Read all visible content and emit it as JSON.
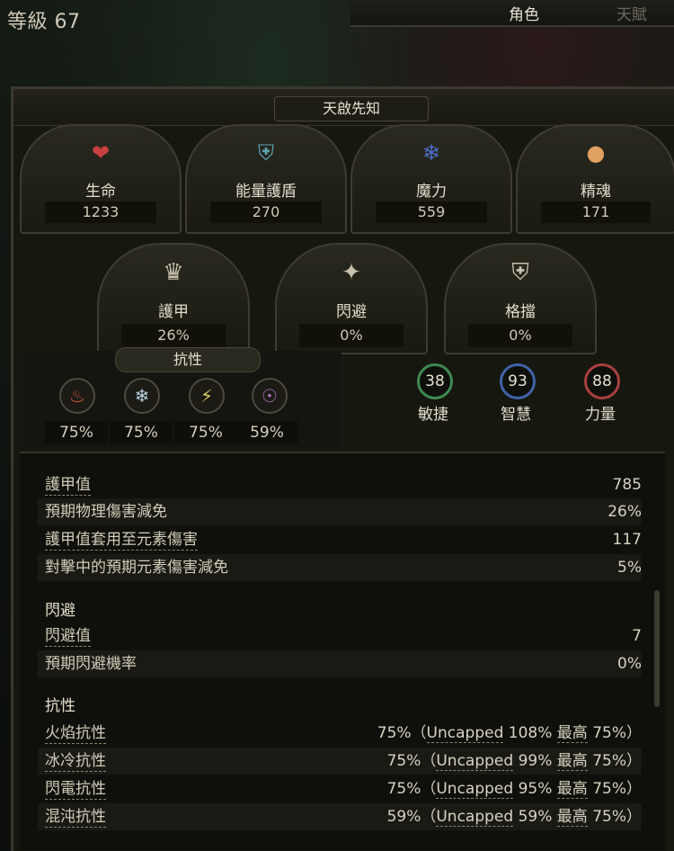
{
  "header": {
    "level_label": "等級 67",
    "tabs": [
      {
        "label": "角色",
        "active": true
      },
      {
        "label": "天賦",
        "active": false
      }
    ]
  },
  "character": {
    "class_name": "天啟先知"
  },
  "pools": [
    {
      "label": "生命",
      "value": "1233",
      "icon": "heart-icon",
      "color": "#c94040"
    },
    {
      "label": "能量護盾",
      "value": "270",
      "icon": "shield-icon",
      "color": "#5fa4b5"
    },
    {
      "label": "魔力",
      "value": "559",
      "icon": "mana-icon",
      "color": "#4a6fc7"
    },
    {
      "label": "精魂",
      "value": "171",
      "icon": "spirit-icon",
      "color": "#e0a060"
    }
  ],
  "defences": [
    {
      "label": "護甲",
      "value": "26%",
      "icon": "armour-icon"
    },
    {
      "label": "閃避",
      "value": "0%",
      "icon": "evasion-icon"
    },
    {
      "label": "格擋",
      "value": "0%",
      "icon": "block-icon"
    }
  ],
  "resistances": {
    "title": "抗性",
    "items": [
      {
        "value": "75%",
        "icon": "fire-icon",
        "color": "#d05a3a"
      },
      {
        "value": "75%",
        "icon": "cold-icon",
        "color": "#bfd4e6"
      },
      {
        "value": "75%",
        "icon": "lightning-icon",
        "color": "#e0d060"
      },
      {
        "value": "59%",
        "icon": "chaos-icon",
        "color": "#b070c0"
      }
    ]
  },
  "attributes": [
    {
      "value": "38",
      "label": "敏捷",
      "color": "#3f8a52"
    },
    {
      "value": "93",
      "label": "智慧",
      "color": "#3f64a8"
    },
    {
      "value": "88",
      "label": "力量",
      "color": "#a83f3f"
    }
  ],
  "details": {
    "armour_rows": [
      {
        "k": "護甲值",
        "v": "785",
        "dotted": true
      },
      {
        "k": "預期物理傷害減免",
        "v": "26%",
        "dotted": false
      },
      {
        "k": "護甲值套用至元素傷害",
        "v": "117",
        "dotted": true
      },
      {
        "k": "對擊中的預期元素傷害減免",
        "v": "5%",
        "dotted": false
      }
    ],
    "evasion_title": "閃避",
    "evasion_rows": [
      {
        "k": "閃避值",
        "v": "7",
        "dotted": true
      },
      {
        "k": "預期閃避機率",
        "v": "0%",
        "dotted": false
      }
    ],
    "res_title": "抗性",
    "res_rows": [
      {
        "k": "火焰抗性",
        "val": "75%",
        "uncapped_label": "Uncapped",
        "uncapped": "108%",
        "max_label": "最高",
        "max": "75%"
      },
      {
        "k": "冰冷抗性",
        "val": "75%",
        "uncapped_label": "Uncapped",
        "uncapped": "99%",
        "max_label": "最高",
        "max": "75%"
      },
      {
        "k": "閃電抗性",
        "val": "75%",
        "uncapped_label": "Uncapped",
        "uncapped": "95%",
        "max_label": "最高",
        "max": "75%"
      },
      {
        "k": "混沌抗性",
        "val": "59%",
        "uncapped_label": "Uncapped",
        "uncapped": "59%",
        "max_label": "最高",
        "max": "75%"
      }
    ]
  }
}
